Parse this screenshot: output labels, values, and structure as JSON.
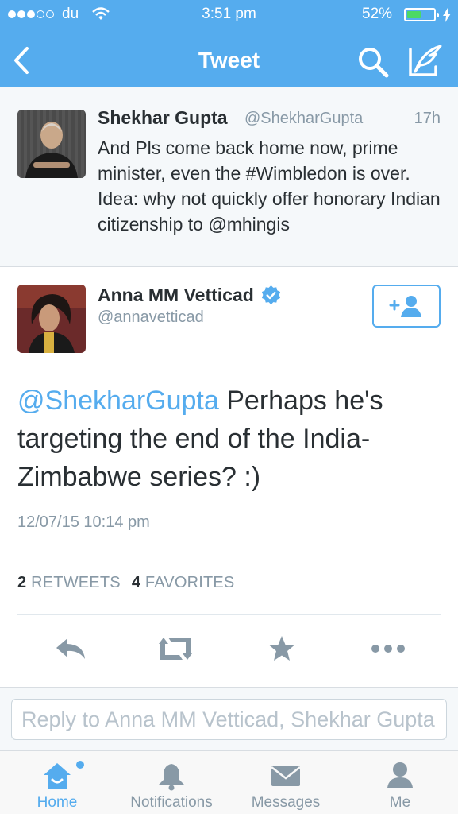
{
  "status_bar": {
    "carrier": "du",
    "time": "3:51 pm",
    "battery_percent": "52%",
    "battery_level": 0.52,
    "signal_bars_filled": 3,
    "signal_bars_total": 5
  },
  "nav": {
    "title": "Tweet",
    "back_icon": "chevron-left-icon",
    "search_icon": "search-icon",
    "compose_icon": "compose-quill-icon"
  },
  "parent_tweet": {
    "name": "Shekhar Gupta",
    "handle": "@ShekharGupta",
    "time_ago": "17h",
    "text": "And Pls come back home now, prime minister, even the #Wimbledon is over. Idea: why not quickly offer honorary Indian citizenship to @mhingis"
  },
  "main_tweet": {
    "name": "Anna MM Vetticad",
    "handle": "@annavetticad",
    "verified": true,
    "mention": "@ShekharGupta",
    "text": " Perhaps he's targeting the end of the India-Zimbabwe series? :)",
    "date": "12/07/15 10:14 pm",
    "retweets_count": "2",
    "retweets_label": "RETWEETS",
    "favorites_count": "4",
    "favorites_label": "FAVORITES"
  },
  "reply": {
    "placeholder": "Reply to Anna MM Vetticad, Shekhar Gupta"
  },
  "tabbar": {
    "items": [
      {
        "label": "Home",
        "icon": "home-icon",
        "active": true
      },
      {
        "label": "Notifications",
        "icon": "bell-icon",
        "active": false
      },
      {
        "label": "Messages",
        "icon": "envelope-icon",
        "active": false
      },
      {
        "label": "Me",
        "icon": "person-icon",
        "active": false
      }
    ]
  },
  "colors": {
    "brand": "#55acee",
    "text": "#292f33",
    "muted": "#8899a6",
    "battery": "#4cd964"
  }
}
